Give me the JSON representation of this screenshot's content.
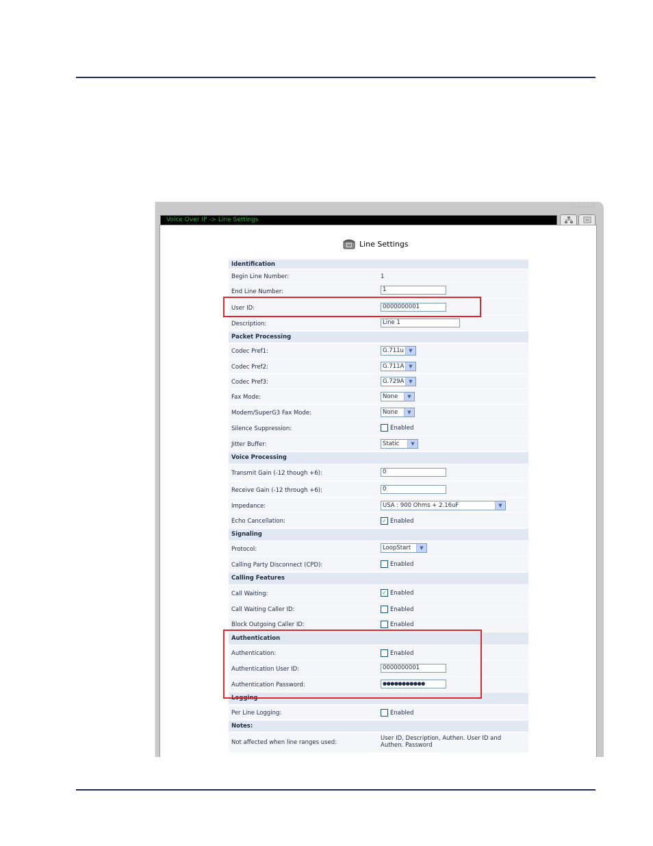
{
  "window": {
    "breadcrumb": "Voice Over IP -> Line Settings",
    "grip": "·········",
    "page_title": "Line Settings",
    "icons": {
      "phone": "phone-icon",
      "sitemap": "sitemap-icon",
      "help": "help-icon"
    }
  },
  "settings": {
    "identification": {
      "header": "Identification",
      "begin_line_label": "Begin Line Number:",
      "begin_line_value": "1",
      "end_line_label": "End Line Number:",
      "end_line_value": "1",
      "user_id_label": "User ID:",
      "user_id_value": "0000000001",
      "description_label": "Description:",
      "description_value": "Line 1"
    },
    "packet": {
      "header": "Packet Processing",
      "codec1_label": "Codec Pref1:",
      "codec1_value": "G.711u",
      "codec2_label": "Codec Pref2:",
      "codec2_value": "G.711A",
      "codec3_label": "Codec Pref3:",
      "codec3_value": "G.729A",
      "fax_label": "Fax Mode:",
      "fax_value": "None",
      "modem_label": "Modem/SuperG3 Fax Mode:",
      "modem_value": "None",
      "silence_label": "Silence Suppression:",
      "silence_checked": false,
      "jitter_label": "Jitter Buffer:",
      "jitter_value": "Static"
    },
    "voice": {
      "header": "Voice Processing",
      "tx_label": "Transmit Gain (-12 though +6):",
      "tx_value": "0",
      "rx_label": "Receive Gain (-12 through +6):",
      "rx_value": "0",
      "impedance_label": "Impedance:",
      "impedance_value": "USA : 900 Ohms + 2.16uF",
      "echo_label": "Echo Cancellation:",
      "echo_checked": true
    },
    "signaling": {
      "header": "Signaling",
      "protocol_label": "Protocol:",
      "protocol_value": "LoopStart",
      "cpd_label": "Calling Party Disconnect (CPD):",
      "cpd_checked": false
    },
    "calling": {
      "header": "Calling Features",
      "cw_label": "Call Waiting:",
      "cw_checked": true,
      "cwcid_label": "Call Waiting Caller ID:",
      "cwcid_checked": false,
      "block_label": "Block Outgoing Caller ID:",
      "block_checked": false
    },
    "auth": {
      "header": "Authentication",
      "auth_label": "Authentication:",
      "auth_checked": false,
      "user_label": "Authentication User ID:",
      "user_value": "0000000001",
      "pass_label": "Authentication Password:",
      "pass_value": "●●●●●●●●●●●"
    },
    "logging": {
      "header": "Logging",
      "per_line_label": "Per Line Logging:",
      "per_line_checked": false
    },
    "notes": {
      "header": "Notes:",
      "label": "Not affected when line ranges used:",
      "value": "User ID, Description, Authen. User ID and Authen. Password"
    },
    "enabled_text": "Enabled"
  }
}
